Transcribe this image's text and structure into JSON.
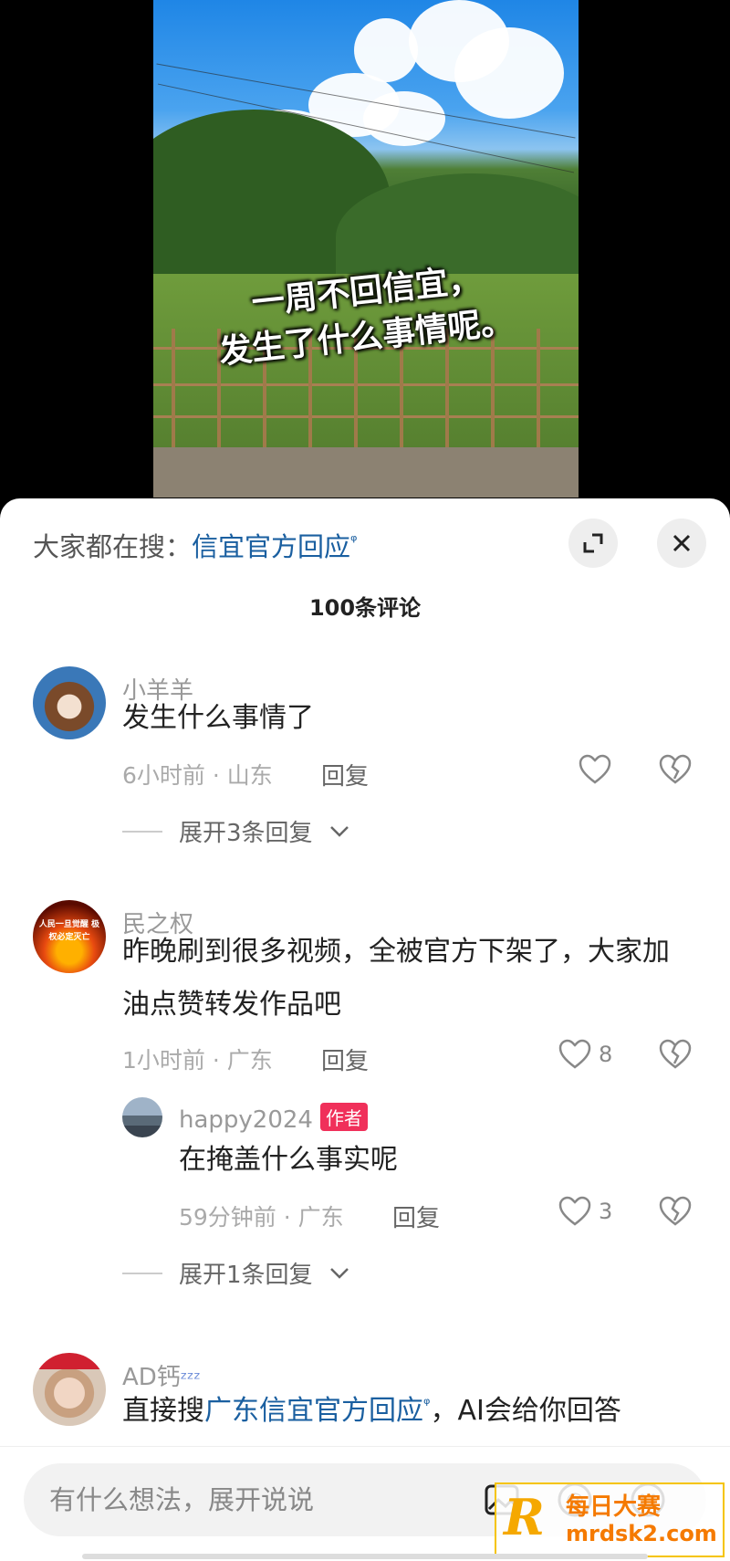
{
  "video": {
    "overlay_line1": "一周不回信宜，",
    "overlay_line2": "发生了什么事情呢。"
  },
  "sheet": {
    "search_prefix": "大家都在搜：",
    "search_keyword": "信宜官方回应",
    "title": "100条评论"
  },
  "comments": [
    {
      "username": "小羊羊",
      "text": "发生什么事情了",
      "meta": "6小时前 · 山东",
      "reply_label": "回复",
      "like_count": "",
      "expand_label": "展开3条回复"
    },
    {
      "username": "民之权",
      "text": "昨晚刷到很多视频，全被官方下架了，大家加油点赞转发作品吧",
      "meta": "1小时前 · 广东",
      "reply_label": "回复",
      "like_count": "8",
      "avatar_text": "人民一旦觉醒 极权必定灭亡",
      "reply": {
        "username": "happy2024",
        "badge": "作者",
        "text": "在掩盖什么事实呢",
        "meta": "59分钟前 · 广东",
        "reply_label": "回复",
        "like_count": "3"
      },
      "expand_label": "展开1条回复"
    },
    {
      "username": "AD钙",
      "username_suffix": "ᶻᶻᶻ",
      "text_prefix": "直接搜",
      "text_link": "广东信宜官方回应",
      "text_suffix": "，AI会给你回答"
    }
  ],
  "input": {
    "placeholder": "有什么想法，展开说说"
  },
  "watermark": {
    "letter": "R",
    "line1": "每日大赛",
    "line2": "mrdsk2.com"
  },
  "colors": {
    "link": "#1a5fa0",
    "author_badge": "#f0305a",
    "watermark": "#f57a00"
  }
}
